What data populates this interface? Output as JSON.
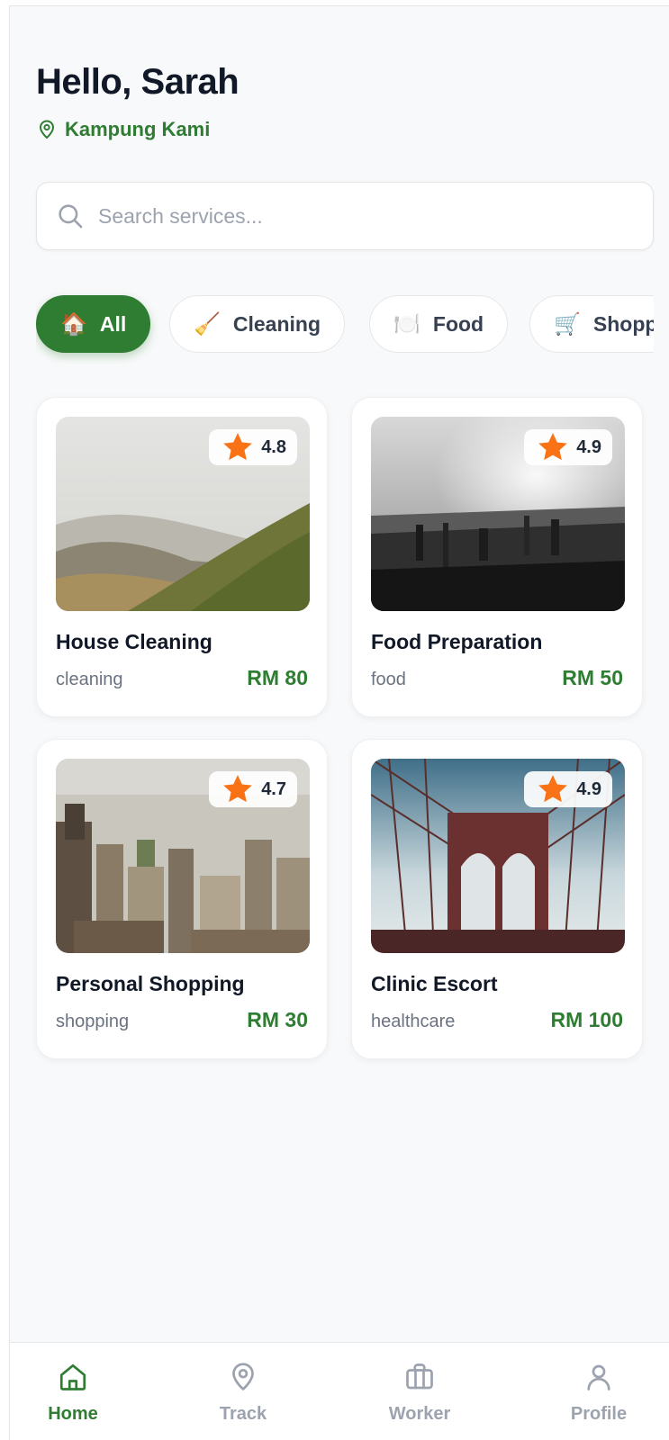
{
  "header": {
    "greeting": "Hello, Sarah",
    "location": "Kampung Kami",
    "location_icon": "map-pin-icon"
  },
  "search": {
    "placeholder": "Search services...",
    "value": "",
    "icon": "search-icon"
  },
  "categories": [
    {
      "emoji": "🏠",
      "label": "All",
      "active": true
    },
    {
      "emoji": "🧹",
      "label": "Cleaning",
      "active": false
    },
    {
      "emoji": "🍽️",
      "label": "Food",
      "active": false
    },
    {
      "emoji": "🛒",
      "label": "Shopping",
      "active": false
    }
  ],
  "services": [
    {
      "title": "House Cleaning",
      "category": "cleaning",
      "price": "RM 80",
      "rating": "4.8",
      "image": "mountain-landscape-photo"
    },
    {
      "title": "Food Preparation",
      "category": "food",
      "price": "RM 50",
      "rating": "4.9",
      "image": "city-skyline-photo"
    },
    {
      "title": "Personal Shopping",
      "category": "shopping",
      "price": "RM 30",
      "rating": "4.7",
      "image": "city-buildings-photo"
    },
    {
      "title": "Clinic Escort",
      "category": "healthcare",
      "price": "RM 100",
      "rating": "4.9",
      "image": "bridge-photo"
    }
  ],
  "bottom_nav": [
    {
      "label": "Home",
      "icon": "home-icon",
      "active": true
    },
    {
      "label": "Track",
      "icon": "map-pin-icon",
      "active": false
    },
    {
      "label": "Worker",
      "icon": "briefcase-icon",
      "active": false
    },
    {
      "label": "Profile",
      "icon": "user-icon",
      "active": false
    }
  ],
  "colors": {
    "accent": "#2e7d32",
    "background": "#f8f9fa",
    "text": "#111827",
    "muted": "#6b7280",
    "star": "#f97316"
  }
}
